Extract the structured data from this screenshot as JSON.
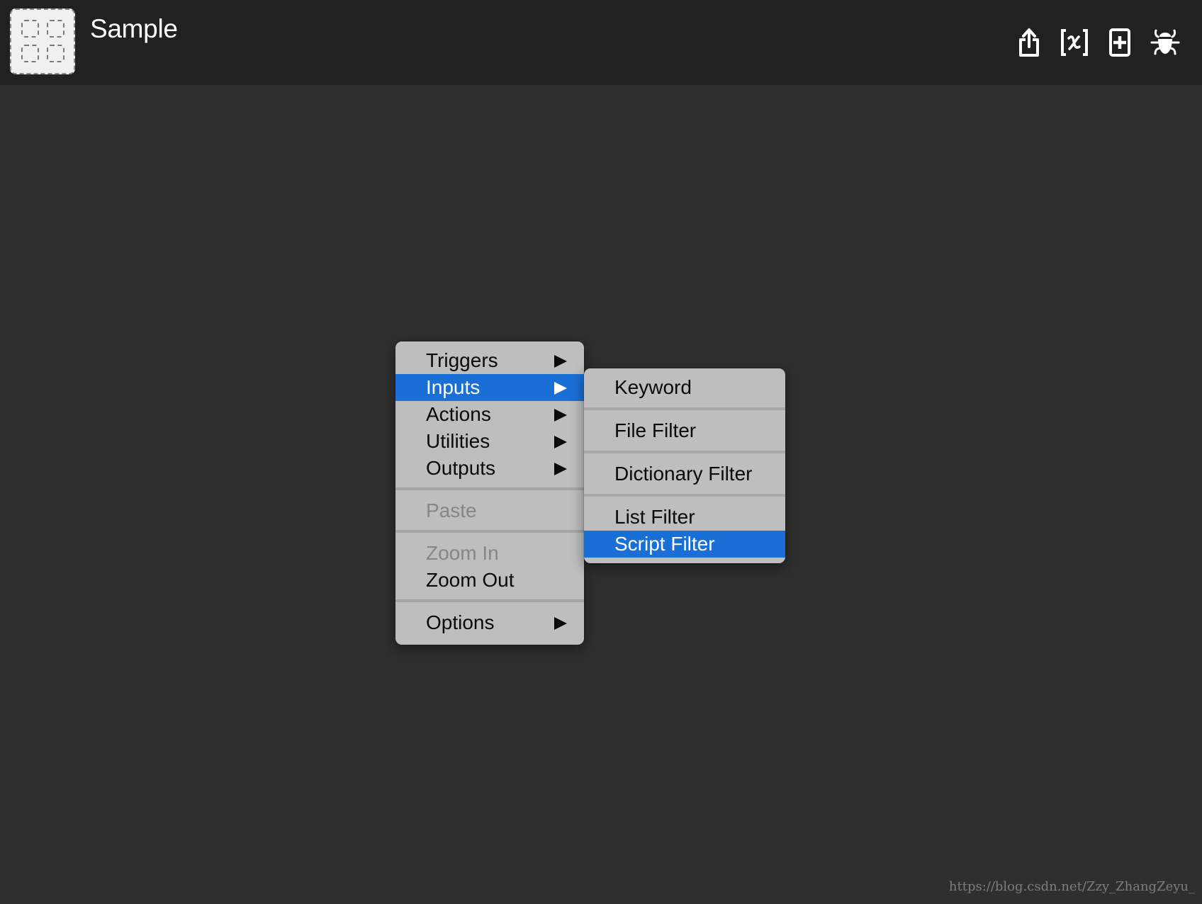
{
  "header": {
    "title": "Sample",
    "logo_icon": "workflow-placeholder-grid-icon",
    "toolbar": [
      {
        "name": "share-icon",
        "label": "Share / Export"
      },
      {
        "name": "variable-icon",
        "label": "Workflow Variables"
      },
      {
        "name": "add-icon",
        "label": "Add"
      },
      {
        "name": "bug-icon",
        "label": "Debugger"
      }
    ]
  },
  "context_menu": {
    "items": [
      {
        "label": "Triggers",
        "submenu": true,
        "selected": false,
        "disabled": false
      },
      {
        "label": "Inputs",
        "submenu": true,
        "selected": true,
        "disabled": false
      },
      {
        "label": "Actions",
        "submenu": true,
        "selected": false,
        "disabled": false
      },
      {
        "label": "Utilities",
        "submenu": true,
        "selected": false,
        "disabled": false
      },
      {
        "label": "Outputs",
        "submenu": true,
        "selected": false,
        "disabled": false
      },
      {
        "label": "Paste",
        "submenu": false,
        "selected": false,
        "disabled": true
      },
      {
        "label": "Zoom In",
        "submenu": false,
        "selected": false,
        "disabled": true
      },
      {
        "label": "Zoom Out",
        "submenu": false,
        "selected": false,
        "disabled": false
      },
      {
        "label": "Options",
        "submenu": true,
        "selected": false,
        "disabled": false
      }
    ]
  },
  "inputs_submenu": {
    "items": [
      {
        "label": "Keyword",
        "selected": false
      },
      {
        "label": "File Filter",
        "selected": false
      },
      {
        "label": "Dictionary Filter",
        "selected": false
      },
      {
        "label": "List Filter",
        "selected": false
      },
      {
        "label": "Script Filter",
        "selected": true
      }
    ]
  },
  "colors": {
    "header_bg": "#212121",
    "canvas_bg": "#2f2f2f",
    "menu_bg": "#bebebe",
    "selection": "#1a6fd6",
    "disabled_text": "#868686"
  },
  "watermark": "https://blog.csdn.net/Zzy_ZhangZeyu_"
}
